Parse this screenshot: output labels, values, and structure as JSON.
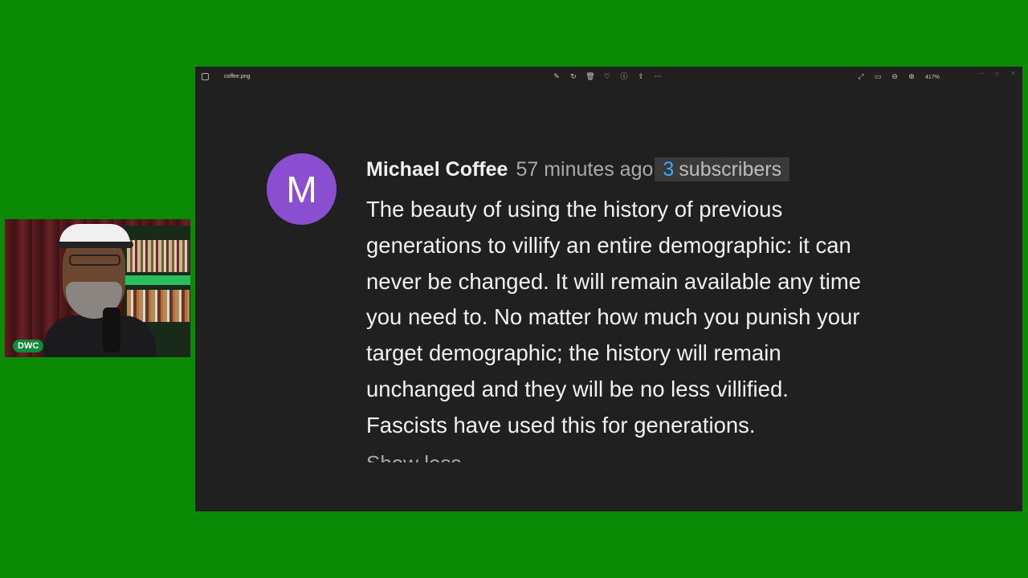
{
  "viewer": {
    "filename": "coffee.png",
    "zoom": "417%",
    "toolbar_icons": [
      "edit-icon",
      "rotate-icon",
      "delete-icon",
      "favorite-icon",
      "info-icon",
      "share-icon",
      "more-icon"
    ],
    "right_icons": [
      "fullscreen-icon",
      "fit-icon",
      "zoom-out-icon",
      "zoom-in-icon"
    ]
  },
  "comment": {
    "avatar_letter": "M",
    "avatar_color": "#8a4fd1",
    "author": "Michael Coffee",
    "time": "57 minutes ago",
    "subscriber_count": "3",
    "subscriber_label": "subscribers",
    "text": "The beauty of using the history of previous\ngenerations to villify an entire demographic: it can\nnever be changed.  It will remain available any time\nyou need to. No matter how much you punish your\ntarget demographic; the history will remain\nunchanged and they will be no less villified.\nFascists have used this for generations.",
    "show_less": "Show less"
  },
  "webcam": {
    "label": "DWC"
  },
  "colors": {
    "background": "#0b8a06",
    "viewer_bg": "#202020",
    "link_blue": "#3ea6ff"
  }
}
